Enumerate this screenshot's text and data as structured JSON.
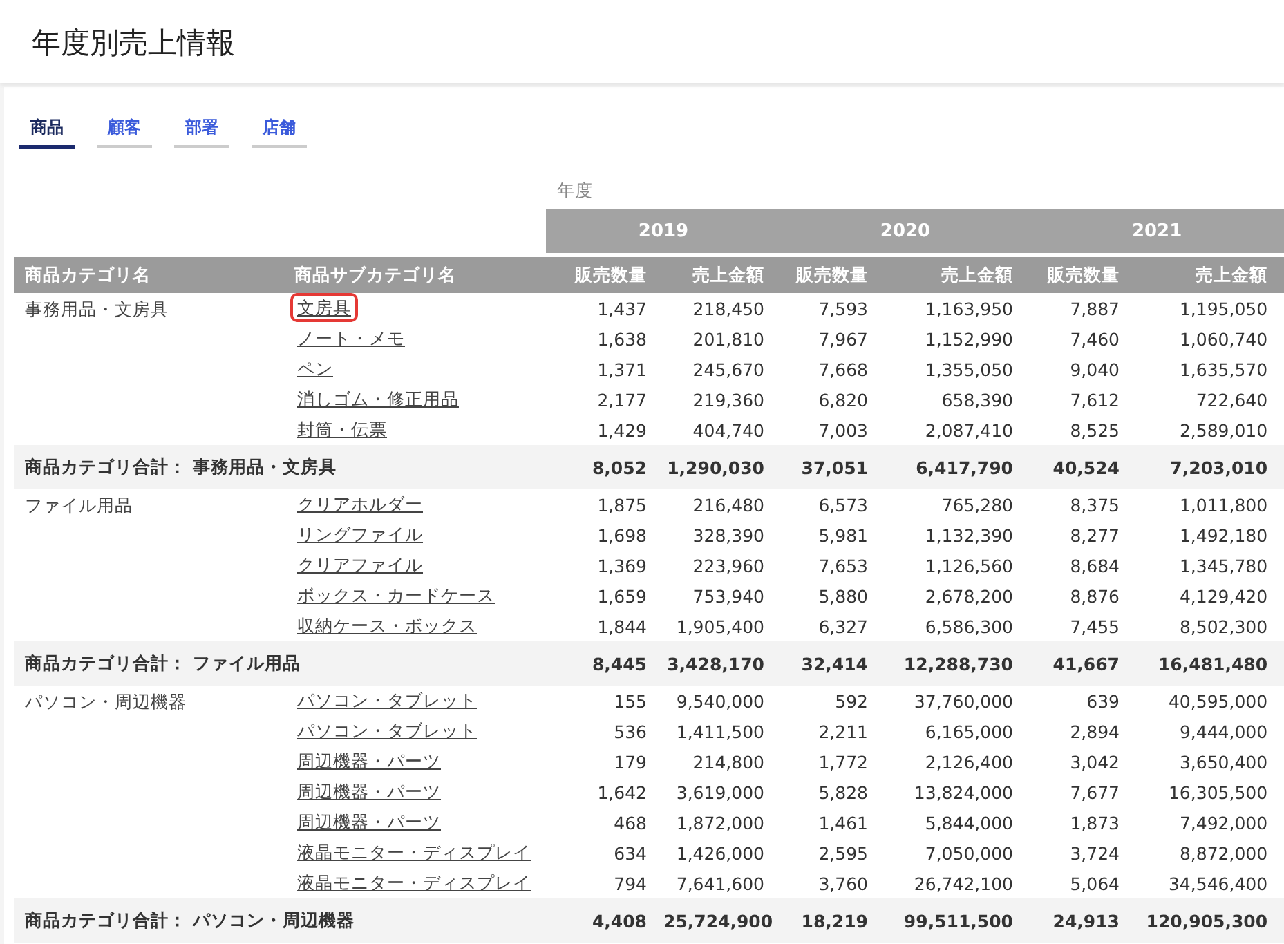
{
  "page_title": "年度別売上情報",
  "tabs": [
    {
      "label": "商品",
      "selected": true
    },
    {
      "label": "顧客",
      "selected": false
    },
    {
      "label": "部署",
      "selected": false
    },
    {
      "label": "店舗",
      "selected": false
    }
  ],
  "table": {
    "axis_label": "年度",
    "years": [
      "2019",
      "2020",
      "2021"
    ],
    "columns": [
      "商品カテゴリ名",
      "商品サブカテゴリ名",
      "販売数量",
      "売上金額",
      "販売数量",
      "売上金額",
      "販売数量",
      "売上金額"
    ],
    "groups": [
      {
        "category": "事務用品・文房具",
        "rows": [
          {
            "subcategory": "文房具",
            "highlighted": true,
            "values": [
              "1,437",
              "218,450",
              "7,593",
              "1,163,950",
              "7,887",
              "1,195,050"
            ]
          },
          {
            "subcategory": "ノート・メモ",
            "highlighted": false,
            "values": [
              "1,638",
              "201,810",
              "7,967",
              "1,152,990",
              "7,460",
              "1,060,740"
            ]
          },
          {
            "subcategory": "ペン",
            "highlighted": false,
            "values": [
              "1,371",
              "245,670",
              "7,668",
              "1,355,050",
              "9,040",
              "1,635,570"
            ]
          },
          {
            "subcategory": "消しゴム・修正用品",
            "highlighted": false,
            "values": [
              "2,177",
              "219,360",
              "6,820",
              "658,390",
              "7,612",
              "722,640"
            ]
          },
          {
            "subcategory": "封筒・伝票",
            "highlighted": false,
            "values": [
              "1,429",
              "404,740",
              "7,003",
              "2,087,410",
              "8,525",
              "2,589,010"
            ]
          }
        ],
        "total": {
          "label": "商品カテゴリ合計： 事務用品・文房具",
          "values": [
            "8,052",
            "1,290,030",
            "37,051",
            "6,417,790",
            "40,524",
            "7,203,010"
          ]
        }
      },
      {
        "category": "ファイル用品",
        "rows": [
          {
            "subcategory": "クリアホルダー",
            "highlighted": false,
            "values": [
              "1,875",
              "216,480",
              "6,573",
              "765,280",
              "8,375",
              "1,011,800"
            ]
          },
          {
            "subcategory": "リングファイル",
            "highlighted": false,
            "values": [
              "1,698",
              "328,390",
              "5,981",
              "1,132,390",
              "8,277",
              "1,492,180"
            ]
          },
          {
            "subcategory": "クリアファイル",
            "highlighted": false,
            "values": [
              "1,369",
              "223,960",
              "7,653",
              "1,126,560",
              "8,684",
              "1,345,780"
            ]
          },
          {
            "subcategory": "ボックス・カードケース",
            "highlighted": false,
            "values": [
              "1,659",
              "753,940",
              "5,880",
              "2,678,200",
              "8,876",
              "4,129,420"
            ]
          },
          {
            "subcategory": "収納ケース・ボックス",
            "highlighted": false,
            "values": [
              "1,844",
              "1,905,400",
              "6,327",
              "6,586,300",
              "7,455",
              "8,502,300"
            ]
          }
        ],
        "total": {
          "label": "商品カテゴリ合計： ファイル用品",
          "values": [
            "8,445",
            "3,428,170",
            "32,414",
            "12,288,730",
            "41,667",
            "16,481,480"
          ]
        }
      },
      {
        "category": "パソコン・周辺機器",
        "rows": [
          {
            "subcategory": "パソコン・タブレット",
            "highlighted": false,
            "values": [
              "155",
              "9,540,000",
              "592",
              "37,760,000",
              "639",
              "40,595,000"
            ]
          },
          {
            "subcategory": "パソコン・タブレット",
            "highlighted": false,
            "values": [
              "536",
              "1,411,500",
              "2,211",
              "6,165,000",
              "2,894",
              "9,444,000"
            ]
          },
          {
            "subcategory": "周辺機器・パーツ",
            "highlighted": false,
            "values": [
              "179",
              "214,800",
              "1,772",
              "2,126,400",
              "3,042",
              "3,650,400"
            ]
          },
          {
            "subcategory": "周辺機器・パーツ",
            "highlighted": false,
            "values": [
              "1,642",
              "3,619,000",
              "5,828",
              "13,824,000",
              "7,677",
              "16,305,500"
            ]
          },
          {
            "subcategory": "周辺機器・パーツ",
            "highlighted": false,
            "values": [
              "468",
              "1,872,000",
              "1,461",
              "5,844,000",
              "1,873",
              "7,492,000"
            ]
          },
          {
            "subcategory": "液晶モニター・ディスプレイ",
            "highlighted": false,
            "values": [
              "634",
              "1,426,000",
              "2,595",
              "7,050,000",
              "3,724",
              "8,872,000"
            ]
          },
          {
            "subcategory": "液晶モニター・ディスプレイ",
            "highlighted": false,
            "values": [
              "794",
              "7,641,600",
              "3,760",
              "26,742,100",
              "5,064",
              "34,546,400"
            ]
          }
        ],
        "total": {
          "label": "商品カテゴリ合計： パソコン・周辺機器",
          "values": [
            "4,408",
            "25,724,900",
            "18,219",
            "99,511,500",
            "24,913",
            "120,905,300"
          ]
        }
      }
    ]
  }
}
